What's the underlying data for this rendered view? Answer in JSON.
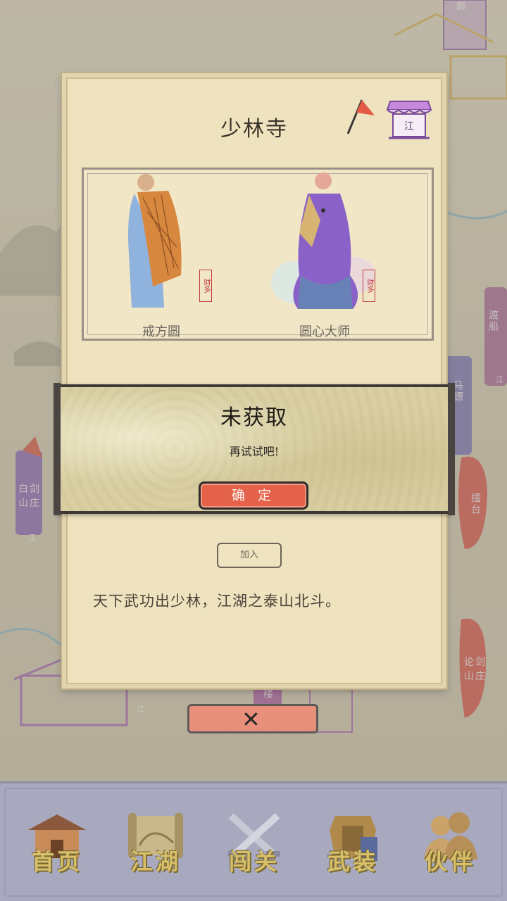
{
  "panel": {
    "title": "少林寺",
    "shop_label": "江",
    "characters": [
      {
        "name": "戒方圆",
        "stamp": "财多"
      },
      {
        "name": "圆心大师",
        "stamp": "财多"
      }
    ],
    "join_label": "加入",
    "description": "天下武功出少林，江湖之泰山北斗。",
    "close_symbol": "✕"
  },
  "dialog": {
    "title": "未获取",
    "message": "再试试吧!",
    "confirm_label": "确 定"
  },
  "map": {
    "labels": [
      "白剑山庄",
      "渡船",
      "马镖",
      "擂台",
      "论剑山庄",
      "楼"
    ],
    "signs": [
      "圆",
      "江",
      "江",
      "江"
    ]
  },
  "nav": {
    "items": [
      {
        "label": "首页",
        "icon": "house-icon"
      },
      {
        "label": "江湖",
        "icon": "scroll-icon"
      },
      {
        "label": "闯关",
        "icon": "crossed-swords-icon"
      },
      {
        "label": "武装",
        "icon": "armor-icon"
      },
      {
        "label": "伙伴",
        "icon": "companions-icon"
      }
    ]
  },
  "colors": {
    "panel_bg": "#efe3bf",
    "confirm_button": "#e4624a",
    "close_button": "#e8907c",
    "nav_bg": "#a8a9bf",
    "nav_text": "#d8c06a"
  }
}
